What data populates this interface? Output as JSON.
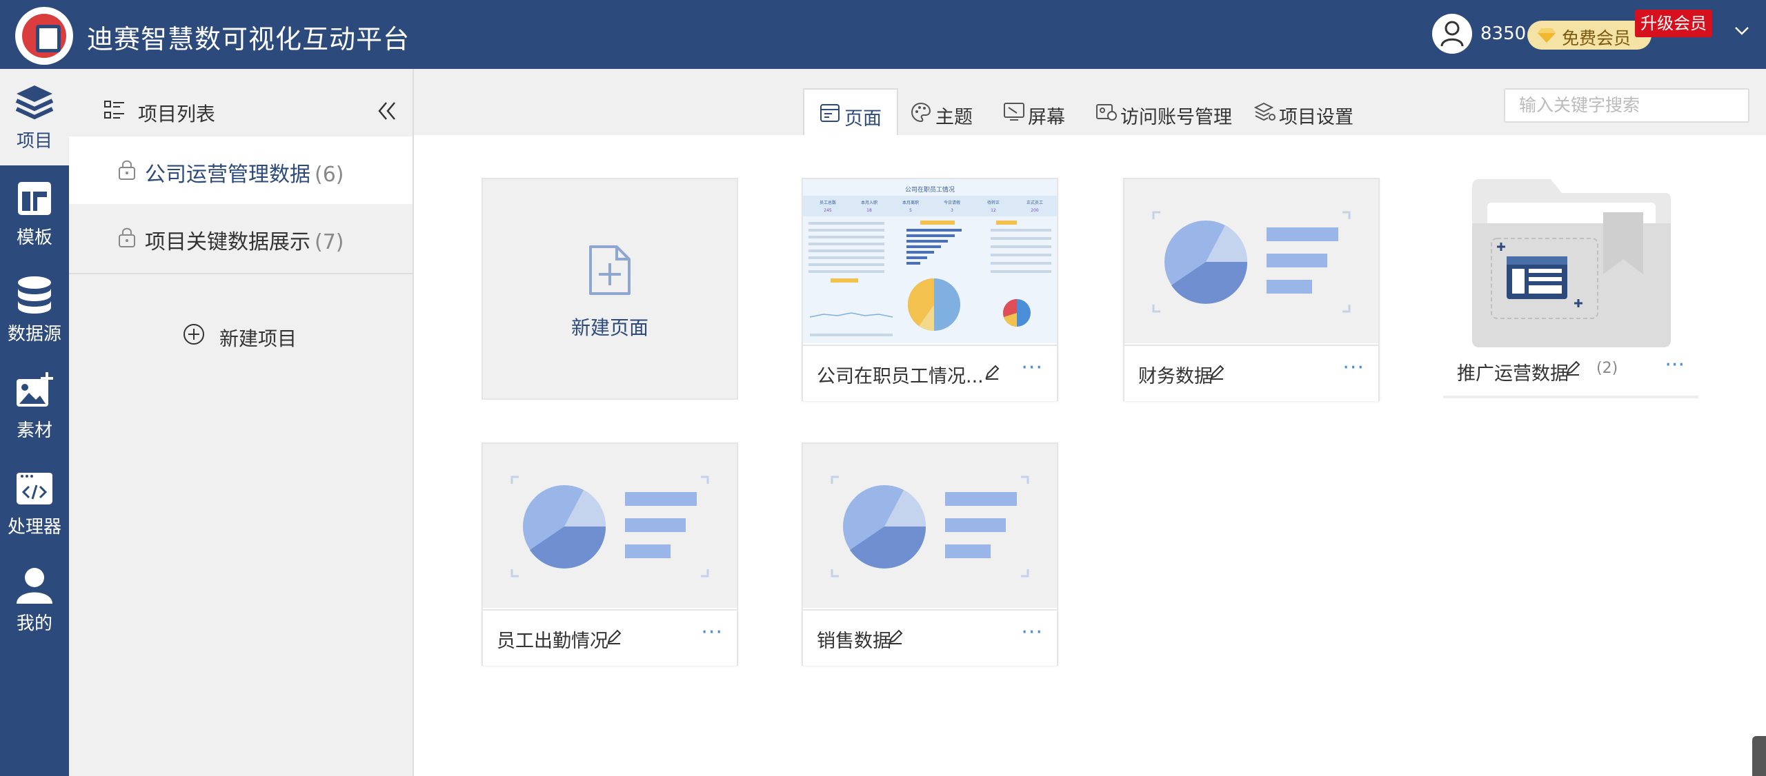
{
  "header": {
    "app_title": "迪赛智慧数可视化互动平台",
    "points": "8350",
    "member_label": "免费会员",
    "upgrade_label": "升级会员"
  },
  "iconbar": {
    "items": [
      {
        "label": "项目",
        "icon": "layers-icon",
        "active": true
      },
      {
        "label": "模板",
        "icon": "template-icon",
        "active": false
      },
      {
        "label": "数据源",
        "icon": "database-icon",
        "active": false
      },
      {
        "label": "素材",
        "icon": "image-add-icon",
        "active": false
      },
      {
        "label": "处理器",
        "icon": "code-window-icon",
        "active": false
      },
      {
        "label": "我的",
        "icon": "user-icon",
        "active": false
      }
    ]
  },
  "sidebar": {
    "title": "项目列表",
    "projects": [
      {
        "name": "公司运营管理数据",
        "count": "(6)",
        "active": true
      },
      {
        "name": "项目关键数据展示",
        "count": "(7)",
        "active": false
      }
    ],
    "new_project_label": "新建项目"
  },
  "tabs": [
    {
      "label": "页面",
      "icon": "page-icon",
      "active": true
    },
    {
      "label": "主题",
      "icon": "palette-icon",
      "active": false
    },
    {
      "label": "屏幕",
      "icon": "screen-icon",
      "active": false
    },
    {
      "label": "访问账号管理",
      "icon": "account-icon",
      "active": false
    },
    {
      "label": "项目设置",
      "icon": "settings-layers-icon",
      "active": false
    }
  ],
  "search": {
    "placeholder": "输入关键字搜索"
  },
  "new_page_label": "新建页面",
  "cards": [
    {
      "name": "公司在职员工情况...",
      "more": "···"
    },
    {
      "name": "财务数据",
      "more": "···"
    },
    {
      "name": "员工出勤情况",
      "more": "···"
    },
    {
      "name": "销售数据",
      "more": "···"
    }
  ],
  "folder": {
    "name": "推广运营数据",
    "count": "(2)",
    "more": "···"
  },
  "thumbnail_text": {
    "dashboard_title": "公司在职员工情况",
    "kpi_labels": [
      "员工总数",
      "本月入职",
      "本月离职",
      "今日请假",
      "待转正",
      "正式员工"
    ],
    "kpi_values": [
      "245",
      "18",
      "5",
      "3",
      "12",
      "200"
    ]
  },
  "colors": {
    "brand": "#2c4a7c",
    "accent_blue": "#4a8ed8",
    "upgrade_red": "#d7101e",
    "member_gold": "#f5e3a6",
    "chart_blue": "#9ab6e8",
    "chart_dark": "#6f8fd0"
  }
}
